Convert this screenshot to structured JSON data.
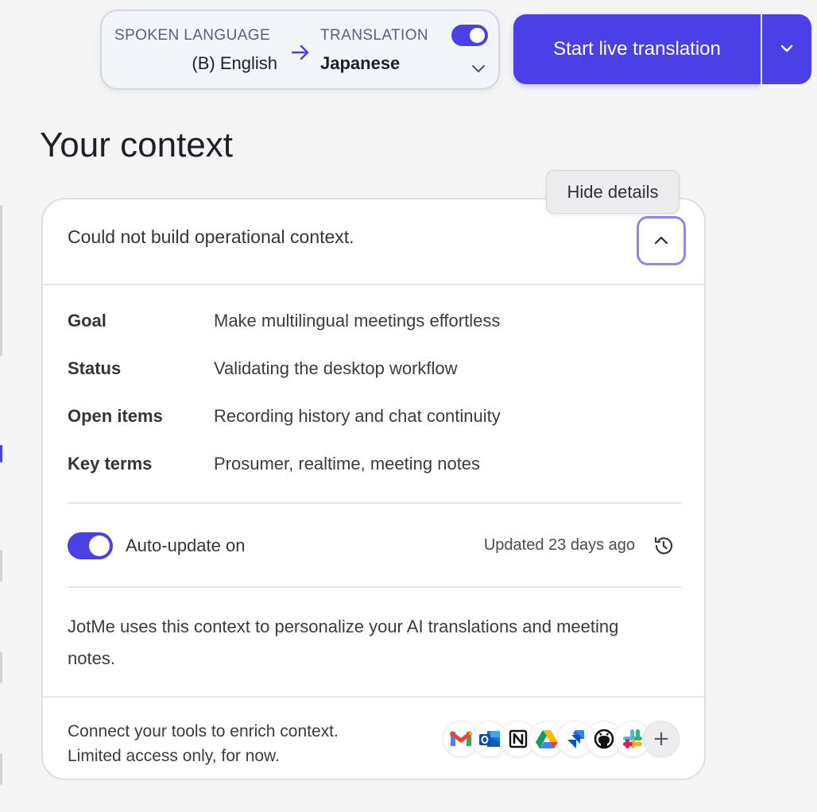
{
  "language_selector": {
    "spoken_caption": "SPOKEN LANGUAGE",
    "spoken_value": "(B) English",
    "translation_caption": "TRANSLATION",
    "translation_value": "Japanese",
    "translation_enabled": true,
    "icons": [
      "arrow-right-icon",
      "toggle",
      "chevron-down-icon"
    ]
  },
  "start_button": {
    "label": "Start live translation",
    "split_icon": "chevron-down-icon"
  },
  "page": {
    "title": "Your context"
  },
  "tooltip": {
    "text": "Hide details"
  },
  "context_card": {
    "message": "Could not build operational context.",
    "collapse_icon": "chevron-up-icon",
    "details": [
      {
        "key": "Goal",
        "value": "Make multilingual meetings effortless"
      },
      {
        "key": "Status",
        "value": "Validating the desktop workflow"
      },
      {
        "key": "Open items",
        "value": "Recording history and chat continuity"
      },
      {
        "key": "Key terms",
        "value": "Prosumer, realtime, meeting notes"
      }
    ],
    "auto_update": {
      "enabled": true,
      "label": "Auto-update on",
      "updated_text": "Updated 23 days ago",
      "history_icon": "history-icon"
    },
    "info": "JotMe uses this context to personalize your AI translations and meeting notes.",
    "footer": {
      "line1": "Connect your tools to enrich context.",
      "line2": "Limited access only, for now.",
      "tools": [
        "gmail-icon",
        "outlook-icon",
        "notion-icon",
        "google-drive-icon",
        "jira-icon",
        "github-icon",
        "slack-icon"
      ],
      "more_label": "+"
    }
  },
  "colors": {
    "accent": "#4a40e6",
    "background": "#f5f5f6",
    "card": "#ffffff"
  }
}
